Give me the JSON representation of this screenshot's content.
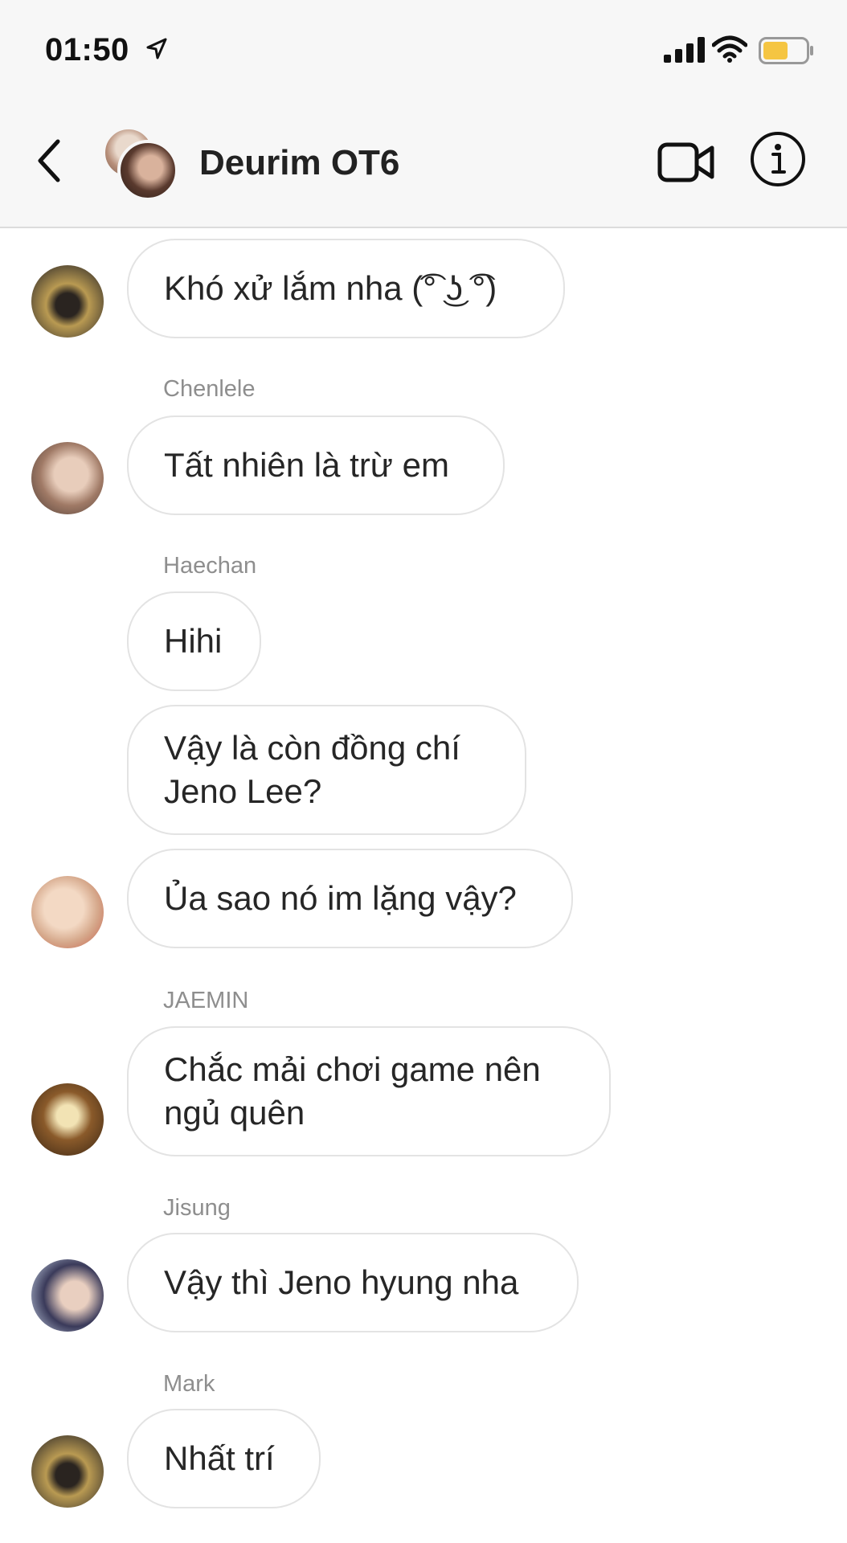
{
  "status_bar": {
    "time": "01:50",
    "battery_color": "#f5c542"
  },
  "header": {
    "title": "Deurim OT6",
    "icons": [
      "back-chevron-icon",
      "video-call-icon",
      "info-icon"
    ]
  },
  "messages": [
    {
      "sender": "",
      "text": "Khó xử lắm nha (͡° ͜ʖ ͡°)",
      "avatar": "avatar-1"
    },
    {
      "sender": "Chenlele",
      "text": "Tất nhiên là trừ em",
      "avatar": "avatar-2"
    },
    {
      "sender": "Haechan",
      "text": "Hihi",
      "avatar": ""
    },
    {
      "sender": "",
      "text": "Vậy là còn đồng chí Jeno Lee?",
      "avatar": ""
    },
    {
      "sender": "",
      "text": "Ủa sao nó im lặng vậy?",
      "avatar": "avatar-3"
    },
    {
      "sender": "JAEMIN",
      "text": "Chắc mải chơi game nên ngủ quên",
      "avatar": "avatar-4"
    },
    {
      "sender": "Jisung",
      "text": "Vậy thì Jeno hyung nha",
      "avatar": "avatar-5"
    },
    {
      "sender": "Mark",
      "text": "Nhất trí",
      "avatar": "avatar-1"
    }
  ]
}
